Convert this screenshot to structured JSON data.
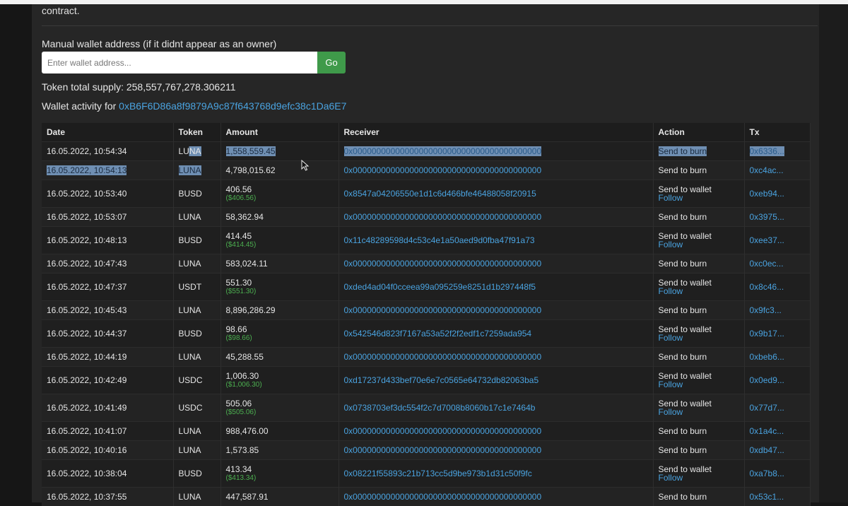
{
  "header": {
    "contract_text": "contract.",
    "manual_label": "Manual wallet address (if it didnt appear as an owner)",
    "input_placeholder": "Enter wallet address...",
    "go_label": "Go",
    "supply_label": "Token total supply:",
    "supply_value": "258,557,767,278.306211",
    "activity_label": "Wallet activity for",
    "wallet_address": "0xB6F6D86a8f9879A9c87f643768d9efc38c1Da6E7"
  },
  "table": {
    "columns": [
      "Date",
      "Token",
      "Amount",
      "Receiver",
      "Action",
      "Tx"
    ],
    "follow_label": "Follow",
    "rows": [
      {
        "date": "16.05.2022, 10:54:34",
        "token": "LUNA",
        "amount": "1,558,559.45",
        "usd": "",
        "receiver": "0x0000000000000000000000000000000000000000",
        "action": "Send to burn",
        "follow": false,
        "tx": "0x6336...",
        "highlight": "row1"
      },
      {
        "date": "16.05.2022, 10:54:13",
        "token": "LUNA",
        "amount": "4,798,015.62",
        "usd": "",
        "receiver": "0x0000000000000000000000000000000000000000",
        "action": "Send to burn",
        "follow": false,
        "tx": "0xc4ac...",
        "highlight": "row2"
      },
      {
        "date": "16.05.2022, 10:53:40",
        "token": "BUSD",
        "amount": "406.56",
        "usd": "($406.56)",
        "receiver": "0x8547a04206550e1d1c6d466bfe46488058f20915",
        "action": "Send to wallet",
        "follow": true,
        "tx": "0xeb94..."
      },
      {
        "date": "16.05.2022, 10:53:07",
        "token": "LUNA",
        "amount": "58,362.94",
        "usd": "",
        "receiver": "0x0000000000000000000000000000000000000000",
        "action": "Send to burn",
        "follow": false,
        "tx": "0x3975..."
      },
      {
        "date": "16.05.2022, 10:48:13",
        "token": "BUSD",
        "amount": "414.45",
        "usd": "($414.45)",
        "receiver": "0x11c48289598d4c53c4e1a50aed9d0fba47f91a73",
        "action": "Send to wallet",
        "follow": true,
        "tx": "0xee37..."
      },
      {
        "date": "16.05.2022, 10:47:43",
        "token": "LUNA",
        "amount": "583,024.11",
        "usd": "",
        "receiver": "0x0000000000000000000000000000000000000000",
        "action": "Send to burn",
        "follow": false,
        "tx": "0xc0ec..."
      },
      {
        "date": "16.05.2022, 10:47:37",
        "token": "USDT",
        "amount": "551.30",
        "usd": "($551.30)",
        "receiver": "0xded4ad04f0cceea99a095259e8251d1b297448f5",
        "action": "Send to wallet",
        "follow": true,
        "tx": "0x8c46..."
      },
      {
        "date": "16.05.2022, 10:45:43",
        "token": "LUNA",
        "amount": "8,896,286.29",
        "usd": "",
        "receiver": "0x0000000000000000000000000000000000000000",
        "action": "Send to burn",
        "follow": false,
        "tx": "0x9fc3..."
      },
      {
        "date": "16.05.2022, 10:44:37",
        "token": "BUSD",
        "amount": "98.66",
        "usd": "($98.66)",
        "receiver": "0x542546d823f7167a53a52f2f2edf1c7259ada954",
        "action": "Send to wallet",
        "follow": true,
        "tx": "0x9b17..."
      },
      {
        "date": "16.05.2022, 10:44:19",
        "token": "LUNA",
        "amount": "45,288.55",
        "usd": "",
        "receiver": "0x0000000000000000000000000000000000000000",
        "action": "Send to burn",
        "follow": false,
        "tx": "0xbeb6..."
      },
      {
        "date": "16.05.2022, 10:42:49",
        "token": "USDC",
        "amount": "1,006.30",
        "usd": "($1,006.30)",
        "receiver": "0xd17237d433bef70e6e7c0565e64732db82063ba5",
        "action": "Send to wallet",
        "follow": true,
        "tx": "0x0ed9..."
      },
      {
        "date": "16.05.2022, 10:41:49",
        "token": "USDC",
        "amount": "505.06",
        "usd": "($505.06)",
        "receiver": "0x0738703ef3dc554f2c7d7008b8060b17c1e7464b",
        "action": "Send to wallet",
        "follow": true,
        "tx": "0x77d7..."
      },
      {
        "date": "16.05.2022, 10:41:07",
        "token": "LUNA",
        "amount": "988,476.00",
        "usd": "",
        "receiver": "0x0000000000000000000000000000000000000000",
        "action": "Send to burn",
        "follow": false,
        "tx": "0x1a4c..."
      },
      {
        "date": "16.05.2022, 10:40:16",
        "token": "LUNA",
        "amount": "1,573.85",
        "usd": "",
        "receiver": "0x0000000000000000000000000000000000000000",
        "action": "Send to burn",
        "follow": false,
        "tx": "0xdb47..."
      },
      {
        "date": "16.05.2022, 10:38:04",
        "token": "BUSD",
        "amount": "413.34",
        "usd": "($413.34)",
        "receiver": "0x08221f55893c21b713cc5d9be973b1d31c50f9fc",
        "action": "Send to wallet",
        "follow": true,
        "tx": "0xa7b8..."
      },
      {
        "date": "16.05.2022, 10:37:55",
        "token": "LUNA",
        "amount": "447,587.91",
        "usd": "",
        "receiver": "0x0000000000000000000000000000000000000000",
        "action": "Send to burn",
        "follow": false,
        "tx": "0x53c1..."
      }
    ]
  },
  "colors": {
    "link": "#4aa3e0",
    "usd": "#4caf50",
    "go_button": "#3f9a4a",
    "selection": "#6f8fb3"
  },
  "icons": {
    "cursor": "mouse-pointer-icon"
  }
}
